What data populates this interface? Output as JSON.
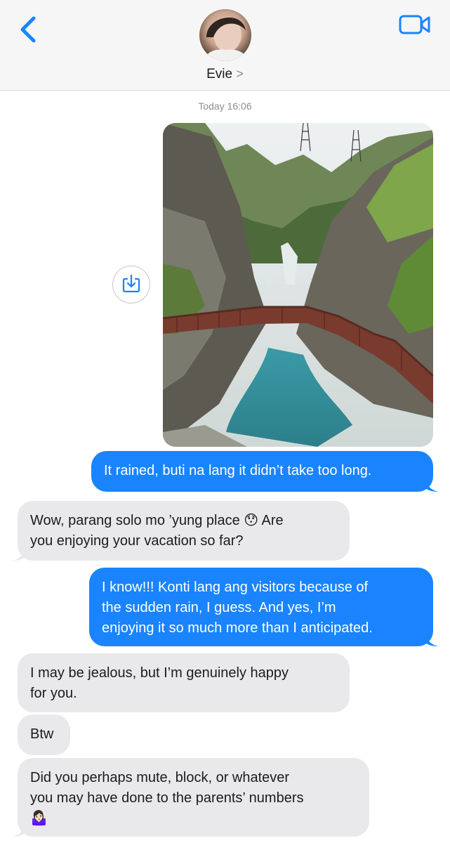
{
  "header": {
    "contact_name": "Evie",
    "contact_chevron": ">",
    "back_icon": "chevron-left-icon",
    "video_icon": "video-camera-icon"
  },
  "timestamp": "Today 16:06",
  "messages": [
    {
      "direction": "outgoing",
      "type": "image"
    },
    {
      "direction": "outgoing",
      "text": "It rained, buti na lang it didn’t take too long."
    },
    {
      "direction": "incoming",
      "lines": [
        "Wow, parang solo mo ’yung place 😯 Are",
        "you enjoying your vacation so far?"
      ]
    },
    {
      "direction": "outgoing",
      "lines": [
        "I know!!! Konti lang ang visitors because of",
        "the sudden rain, I guess. And yes, I’m",
        "enjoying it so much more than I anticipated."
      ]
    },
    {
      "direction": "incoming",
      "lines": [
        "I may be jealous, but I’m genuinely happy",
        "for you."
      ]
    },
    {
      "direction": "incoming",
      "text": "Btw"
    },
    {
      "direction": "incoming",
      "lines": [
        "Did you perhaps mute, block, or whatever",
        "you may have done to the parents’ numbers",
        "🤷🏻‍♀️"
      ]
    }
  ],
  "colors": {
    "outgoing_bubble": "#1a84ff",
    "incoming_bubble": "#e9e9eb",
    "accent": "#1a84ff"
  }
}
